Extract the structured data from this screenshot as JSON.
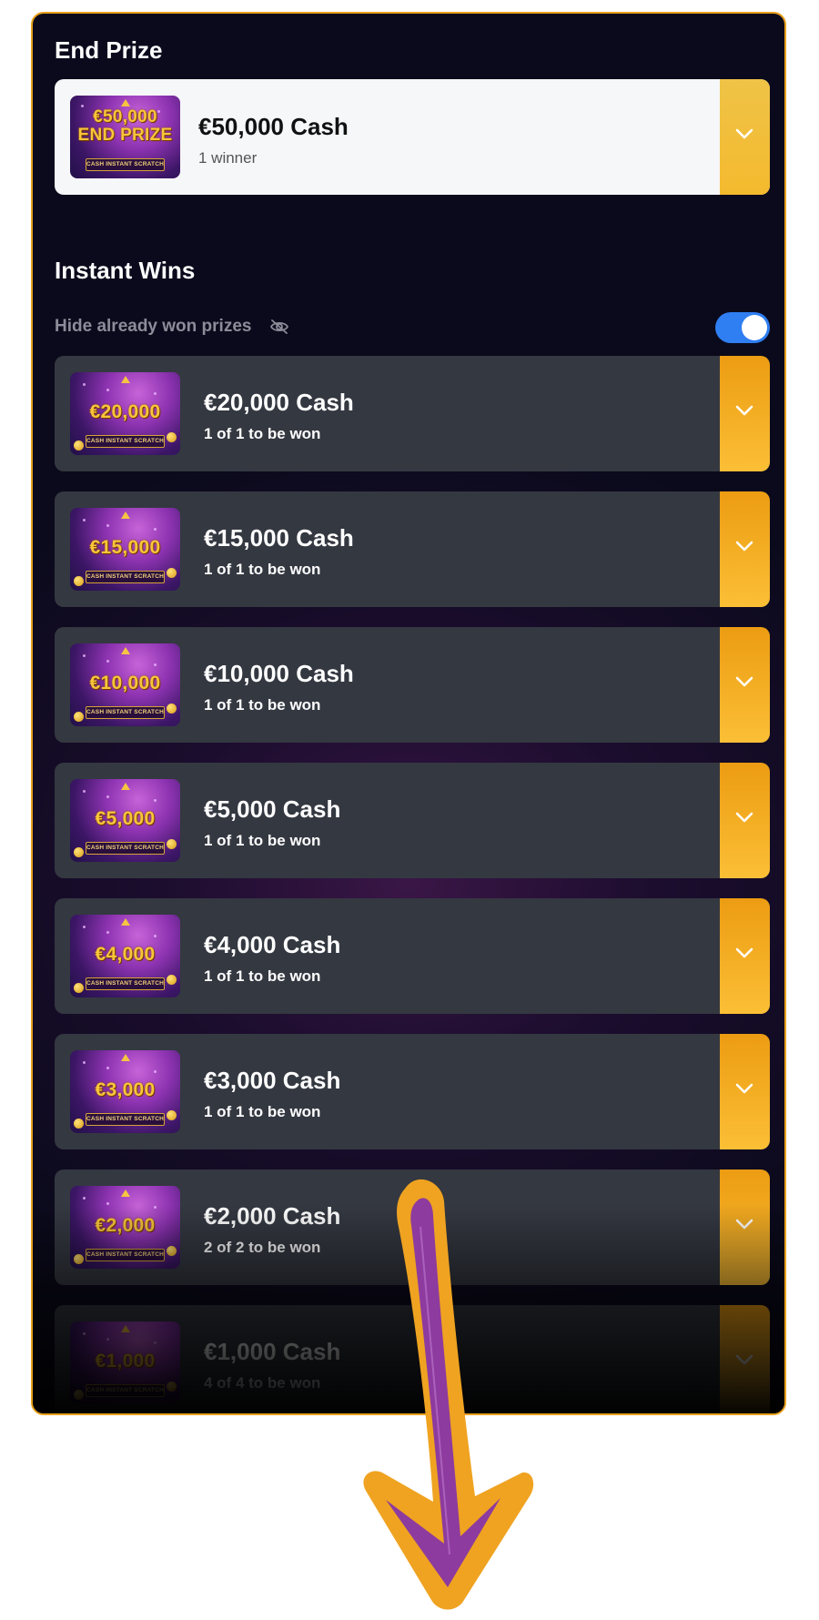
{
  "end_prize": {
    "heading": "End Prize",
    "thumbnail_line1": "€50,000",
    "thumbnail_line2": "END PRIZE",
    "thumbnail_tag": "CASH INSTANT SCRATCH",
    "title": "€50,000 Cash",
    "subtitle": "1 winner"
  },
  "instant_wins": {
    "heading": "Instant Wins",
    "hide_label": "Hide already won prizes",
    "hide_toggle_on": true,
    "prizes": [
      {
        "thumb": "€20,000",
        "tag": "CASH INSTANT SCRATCH",
        "title": "€20,000 Cash",
        "subtitle": "1 of 1 to be won"
      },
      {
        "thumb": "€15,000",
        "tag": "CASH INSTANT SCRATCH",
        "title": "€15,000 Cash",
        "subtitle": "1 of 1 to be won"
      },
      {
        "thumb": "€10,000",
        "tag": "CASH INSTANT SCRATCH",
        "title": "€10,000 Cash",
        "subtitle": "1 of 1 to be won"
      },
      {
        "thumb": "€5,000",
        "tag": "CASH INSTANT SCRATCH",
        "title": "€5,000 Cash",
        "subtitle": "1 of 1 to be won"
      },
      {
        "thumb": "€4,000",
        "tag": "CASH INSTANT SCRATCH",
        "title": "€4,000 Cash",
        "subtitle": "1 of 1 to be won"
      },
      {
        "thumb": "€3,000",
        "tag": "CASH INSTANT SCRATCH",
        "title": "€3,000 Cash",
        "subtitle": "1 of 1 to be won"
      },
      {
        "thumb": "€2,000",
        "tag": "CASH INSTANT SCRATCH",
        "title": "€2,000 Cash",
        "subtitle": "2 of 2 to be won"
      },
      {
        "thumb": "€1,000",
        "tag": "CASH INSTANT SCRATCH",
        "title": "€1,000 Cash",
        "subtitle": "4 of 4 to be won"
      }
    ]
  },
  "icons": {
    "expand": "chevron-down-icon",
    "hide": "eye-off-icon",
    "scroll_hint": "arrow-down-icon"
  },
  "colors": {
    "accent": "#F0A21B",
    "toggle": "#2F7EF2",
    "card": "#343841",
    "end_card": "#F6F7F9",
    "arrow_fill": "#8C3C9C"
  }
}
